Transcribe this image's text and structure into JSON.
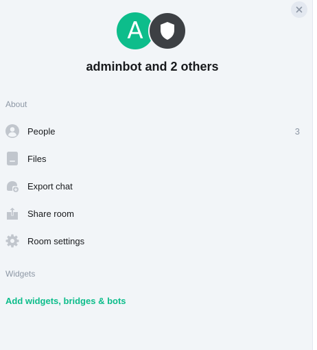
{
  "room": {
    "title": "adminbot and 2 others",
    "avatar_letter": "A"
  },
  "colors": {
    "accent": "#0dbd8b",
    "icon": "#c1c6cd",
    "text_primary": "#17191c",
    "text_secondary": "#8d97a5",
    "panel_bg": "#f2f5f8"
  },
  "about": {
    "heading": "About",
    "items": [
      {
        "label": "People",
        "icon": "person-icon",
        "count": "3"
      },
      {
        "label": "Files",
        "icon": "file-icon"
      },
      {
        "label": "Export chat",
        "icon": "export-chat-icon"
      },
      {
        "label": "Share room",
        "icon": "share-icon"
      },
      {
        "label": "Room settings",
        "icon": "gear-icon"
      }
    ]
  },
  "widgets": {
    "heading": "Widgets",
    "add_link": "Add widgets, bridges & bots"
  }
}
